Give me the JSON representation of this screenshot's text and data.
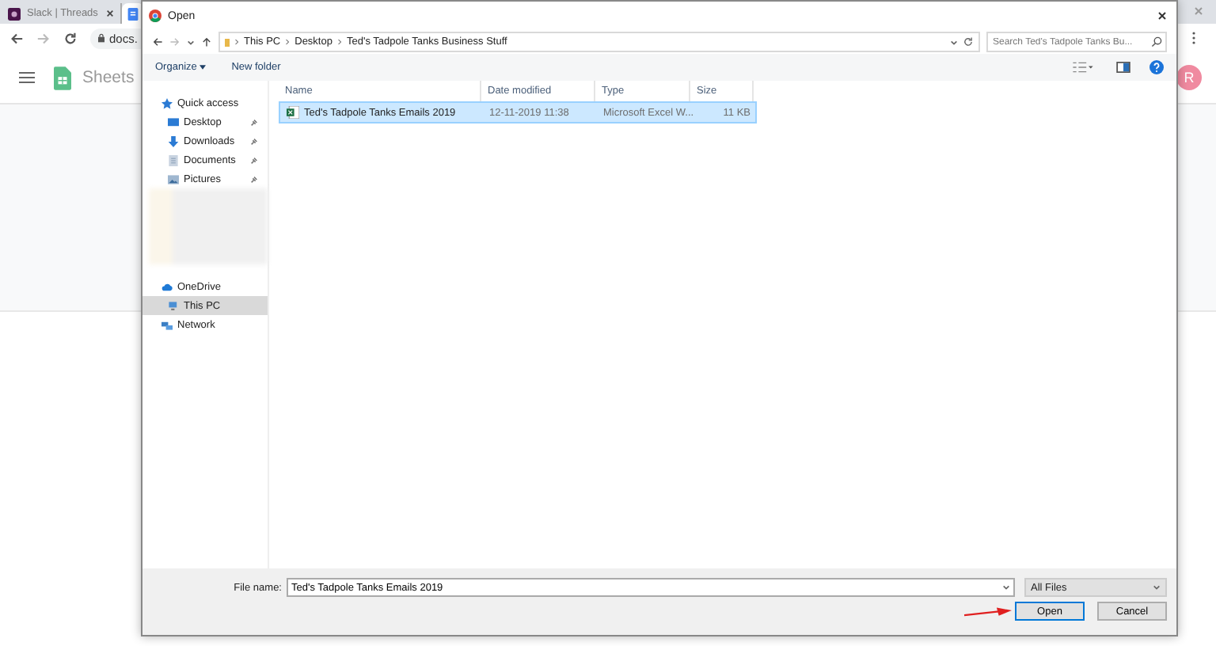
{
  "browser": {
    "tab_title": "Slack | Threads",
    "address": "docs.",
    "app_title": "Sheets",
    "avatar": "R"
  },
  "dialog": {
    "title": "Open",
    "breadcrumb": [
      "This PC",
      "Desktop",
      "Ted's Tadpole Tanks Business Stuff"
    ],
    "search": {
      "placeholder": "Search Ted's Tadpole Tanks Bu..."
    },
    "toolbar": {
      "organize": "Organize",
      "new_folder": "New folder"
    },
    "quick_access": [
      {
        "label": "Quick access",
        "kind": "star",
        "pinned": false,
        "selected": false
      },
      {
        "label": "Desktop",
        "kind": "desktop",
        "pinned": true,
        "selected": false
      },
      {
        "label": "Downloads",
        "kind": "download",
        "pinned": true,
        "selected": false
      },
      {
        "label": "Documents",
        "kind": "document",
        "pinned": true,
        "selected": false
      },
      {
        "label": "Pictures",
        "kind": "pictures",
        "pinned": true,
        "selected": false
      }
    ],
    "locations": [
      {
        "label": "OneDrive",
        "kind": "cloud",
        "pinned": false,
        "selected": false
      },
      {
        "label": "This PC",
        "kind": "pc",
        "pinned": false,
        "selected": true
      },
      {
        "label": "Network",
        "kind": "network",
        "pinned": false,
        "selected": false
      }
    ],
    "columns": [
      "Name",
      "Date modified",
      "Type",
      "Size"
    ],
    "rows": [
      {
        "name": "Ted's Tadpole Tanks Emails 2019",
        "date": "12-11-2019 11:38",
        "type": "Microsoft Excel W...",
        "size": "11 KB",
        "selected": true
      }
    ],
    "file_name_label": "File name:",
    "file_name": "Ted's Tadpole Tanks Emails 2019",
    "filter": "All Files",
    "buttons": [
      "Open",
      "Cancel"
    ]
  }
}
